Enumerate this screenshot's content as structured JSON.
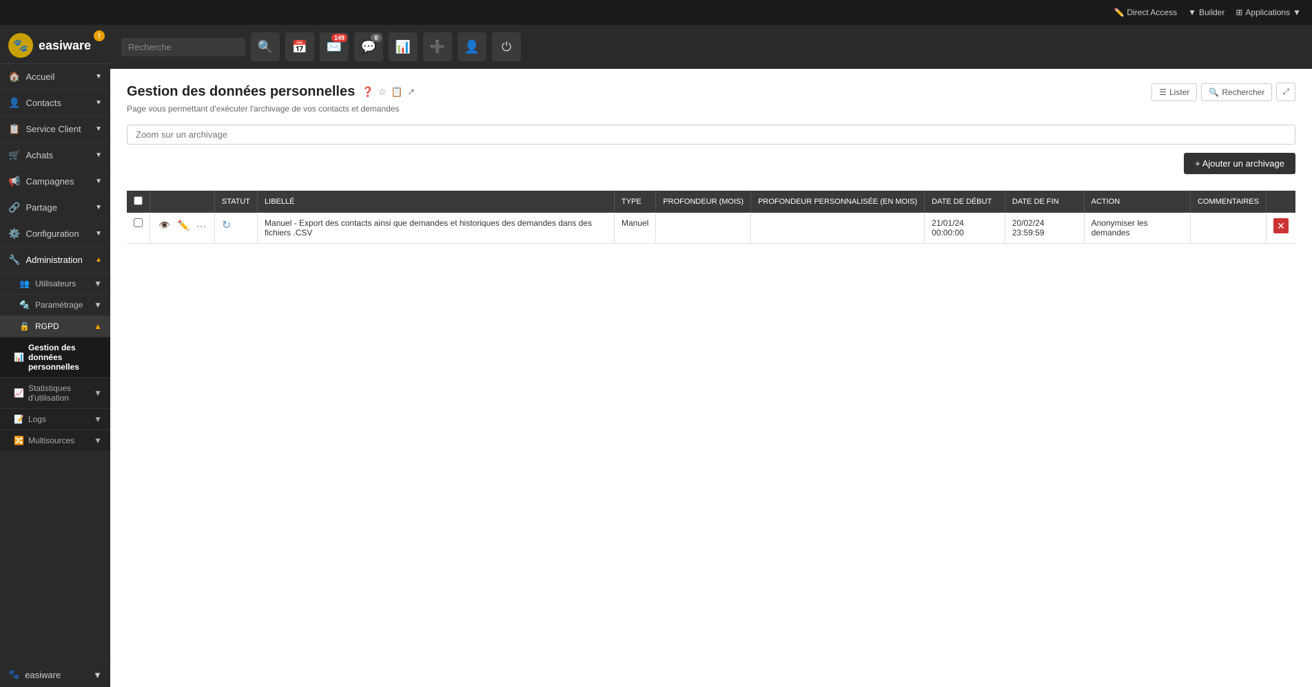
{
  "topbar": {
    "direct_access_label": "Direct Access",
    "builder_label": "Builder",
    "applications_label": "Applications"
  },
  "sidebar": {
    "logo_text": "easiware",
    "notification_count": "!",
    "items": [
      {
        "id": "accueil",
        "label": "Accueil",
        "icon": "🏠",
        "has_arrow": true,
        "active": false
      },
      {
        "id": "contacts",
        "label": "Contacts",
        "icon": "👤",
        "has_arrow": true,
        "active": false
      },
      {
        "id": "service_client",
        "label": "Service Client",
        "icon": "📋",
        "has_arrow": true,
        "active": false
      },
      {
        "id": "achats",
        "label": "Achats",
        "icon": "🛒",
        "has_arrow": true,
        "active": false
      },
      {
        "id": "campagnes",
        "label": "Campagnes",
        "icon": "📢",
        "has_arrow": true,
        "active": false
      },
      {
        "id": "partage",
        "label": "Partage",
        "icon": "🔗",
        "has_arrow": true,
        "active": false
      },
      {
        "id": "configuration",
        "label": "Configuration",
        "icon": "⚙️",
        "has_arrow": true,
        "active": false
      },
      {
        "id": "administration",
        "label": "Administration",
        "icon": "🔧",
        "has_arrow": true,
        "active": true
      }
    ],
    "admin_sub_items": [
      {
        "id": "utilisateurs",
        "label": "Utilisateurs",
        "has_arrow": true
      },
      {
        "id": "parametrage",
        "label": "Paramétrage",
        "has_arrow": true
      },
      {
        "id": "rgpd",
        "label": "RGPD",
        "has_arrow": true,
        "active": true
      }
    ],
    "rgpd_sub_items": [
      {
        "id": "gestion_donnees",
        "label": "Gestion des données personnelles",
        "active": true
      },
      {
        "id": "statistiques",
        "label": "Statistiques d'utilisation",
        "has_arrow": true
      },
      {
        "id": "logs",
        "label": "Logs",
        "has_arrow": true
      },
      {
        "id": "multisources",
        "label": "Multisources",
        "has_arrow": true
      }
    ],
    "footer_item": {
      "label": "easiware",
      "has_arrow": true
    }
  },
  "toolbar": {
    "search_placeholder": "Recherche",
    "search_badge": null,
    "calendar_badge": null,
    "messages_badge": "149",
    "filter_badge": "0",
    "chart_badge": null,
    "add_badge": null,
    "user_badge": null,
    "power_badge": null
  },
  "page": {
    "title": "Gestion des données personnelles",
    "subtitle": "Page vous permettant d'exécuter l'archivage de vos contacts et demandes",
    "zoom_placeholder": "Zoom sur un archivage",
    "list_button": "Lister",
    "search_button": "Rechercher",
    "add_button": "+ Ajouter un archivage"
  },
  "table": {
    "headers": [
      {
        "id": "checkbox",
        "label": ""
      },
      {
        "id": "actions_col",
        "label": ""
      },
      {
        "id": "statut",
        "label": "STATUT"
      },
      {
        "id": "libelle",
        "label": "LIBELLÉ"
      },
      {
        "id": "type",
        "label": "TYPE"
      },
      {
        "id": "profondeur",
        "label": "PROFONDEUR (MOIS)"
      },
      {
        "id": "profondeur_personnalisee",
        "label": "PROFONDEUR PERSONNALISÉE (EN MOIS)"
      },
      {
        "id": "date_debut",
        "label": "DATE DE DÉBUT"
      },
      {
        "id": "date_fin",
        "label": "DATE DE FIN"
      },
      {
        "id": "action",
        "label": "ACTION"
      },
      {
        "id": "commentaires",
        "label": "COMMENTAIRES"
      },
      {
        "id": "delete_col",
        "label": ""
      }
    ],
    "rows": [
      {
        "id": "row1",
        "checked": false,
        "statut_icon": "spinner",
        "libelle": "Manuel - Export des contacts ainsi que demandes et historiques des demandes dans des fichiers .CSV",
        "type": "Manuel",
        "profondeur": "",
        "profondeur_personnalisee": "",
        "date_debut": "21/01/24 00:00:00",
        "date_fin": "20/02/24 23:59:59",
        "action": "Anonymiser les demandes",
        "commentaires": ""
      }
    ]
  }
}
